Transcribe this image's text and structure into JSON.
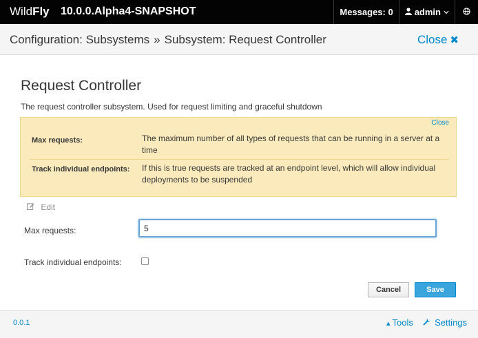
{
  "navbar": {
    "brand_wild": "Wild",
    "brand_fly": "Fly",
    "version": "10.0.0.Alpha4-SNAPSHOT",
    "messages_label": "Messages: 0",
    "user_label": "admin",
    "user_icon": "user-icon",
    "caret_icon": "chevron-down-icon",
    "globe_icon": "globe-icon"
  },
  "header": {
    "crumb_1": "Configuration: Subsystems",
    "separator": "»",
    "crumb_2": "Subsystem: Request Controller",
    "close_label": "Close",
    "close_icon": "close-icon"
  },
  "main": {
    "title": "Request Controller",
    "description": "The request controller subsystem. Used for request limiting and graceful shutdown",
    "help": {
      "close_label": "Close",
      "rows": [
        {
          "key": "Max requests:",
          "value": "The maximum number of all types of requests that can be running in a server at a time"
        },
        {
          "key": "Track individual endpoints:",
          "value": "If this is true requests are tracked at an endpoint level, which will allow individual deployments to be suspended"
        }
      ],
      "background_color": "#fbeabc"
    },
    "edit_label": "Edit",
    "edit_icon": "edit-icon",
    "form": {
      "max_requests_label": "Max requests:",
      "max_requests_value": "5",
      "track_endpoints_label": "Track individual endpoints:",
      "track_endpoints_checked": false
    },
    "buttons": {
      "cancel_label": "Cancel",
      "save_label": "Save",
      "accent_color": "#39a5dc"
    }
  },
  "footer": {
    "version": "0.0.1",
    "tools_label": "Tools",
    "tools_icon": "wrench-icon",
    "settings_label": "Settings",
    "settings_icon": "settings-wrench-icon",
    "link_color": "#0088ce"
  }
}
